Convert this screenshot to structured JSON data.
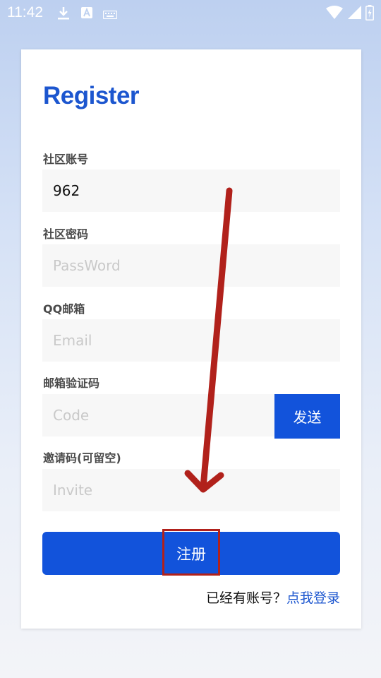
{
  "status_bar": {
    "time": "11:42"
  },
  "colors": {
    "accent": "#1253db",
    "title": "#1c56cf",
    "annotation": "#b1211b"
  },
  "icons": {
    "status_left": [
      "download-icon",
      "keyboard-a-icon",
      "keyboard-icon"
    ],
    "status_right": [
      "wifi-icon",
      "signal-icon",
      "battery-charging-icon"
    ],
    "annotation": "arrow-down-icon"
  },
  "form": {
    "title": "Register",
    "account": {
      "label": "社区账号",
      "value": "962",
      "placeholder": ""
    },
    "password": {
      "label": "社区密码",
      "value": "",
      "placeholder": "PassWord"
    },
    "email": {
      "label": "QQ邮箱",
      "value": "",
      "placeholder": "Email"
    },
    "code": {
      "label": "邮箱验证码",
      "value": "",
      "placeholder": "Code",
      "send_label": "发送"
    },
    "invite": {
      "label": "邀请码(可留空)",
      "value": "",
      "placeholder": "Invite"
    },
    "submit_label": "注册",
    "login_prompt": "已经有账号？",
    "login_link": "点我登录"
  }
}
